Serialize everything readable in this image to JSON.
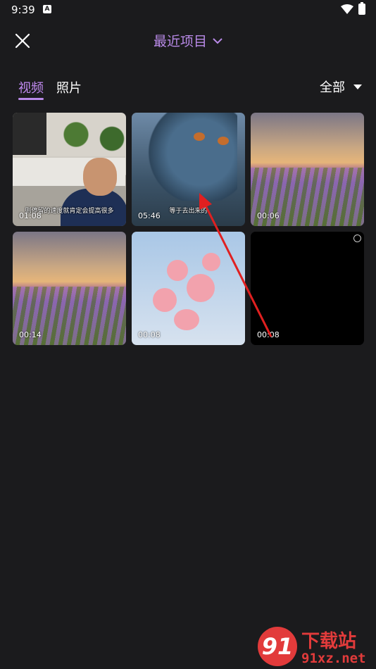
{
  "status": {
    "time": "9:39",
    "notification_icon": "A"
  },
  "header": {
    "title": "最近项目"
  },
  "tabs": [
    {
      "label": "视频"
    },
    {
      "label": "照片"
    }
  ],
  "filter": {
    "label": "全部"
  },
  "media": [
    {
      "duration": "01:08",
      "caption": "则停留的速度就肯定会提高很多"
    },
    {
      "duration": "05:46",
      "caption": "等于去出来的"
    },
    {
      "duration": "00:06"
    },
    {
      "duration": "00:14"
    },
    {
      "duration": "00:08"
    },
    {
      "duration": "00:08"
    }
  ],
  "watermark": {
    "top": "下载站",
    "bottom": "91xz.net",
    "logo": "91"
  },
  "colors": {
    "accent": "#b98ae8",
    "background": "#1b1b1d",
    "annotation_arrow": "#e02020"
  }
}
